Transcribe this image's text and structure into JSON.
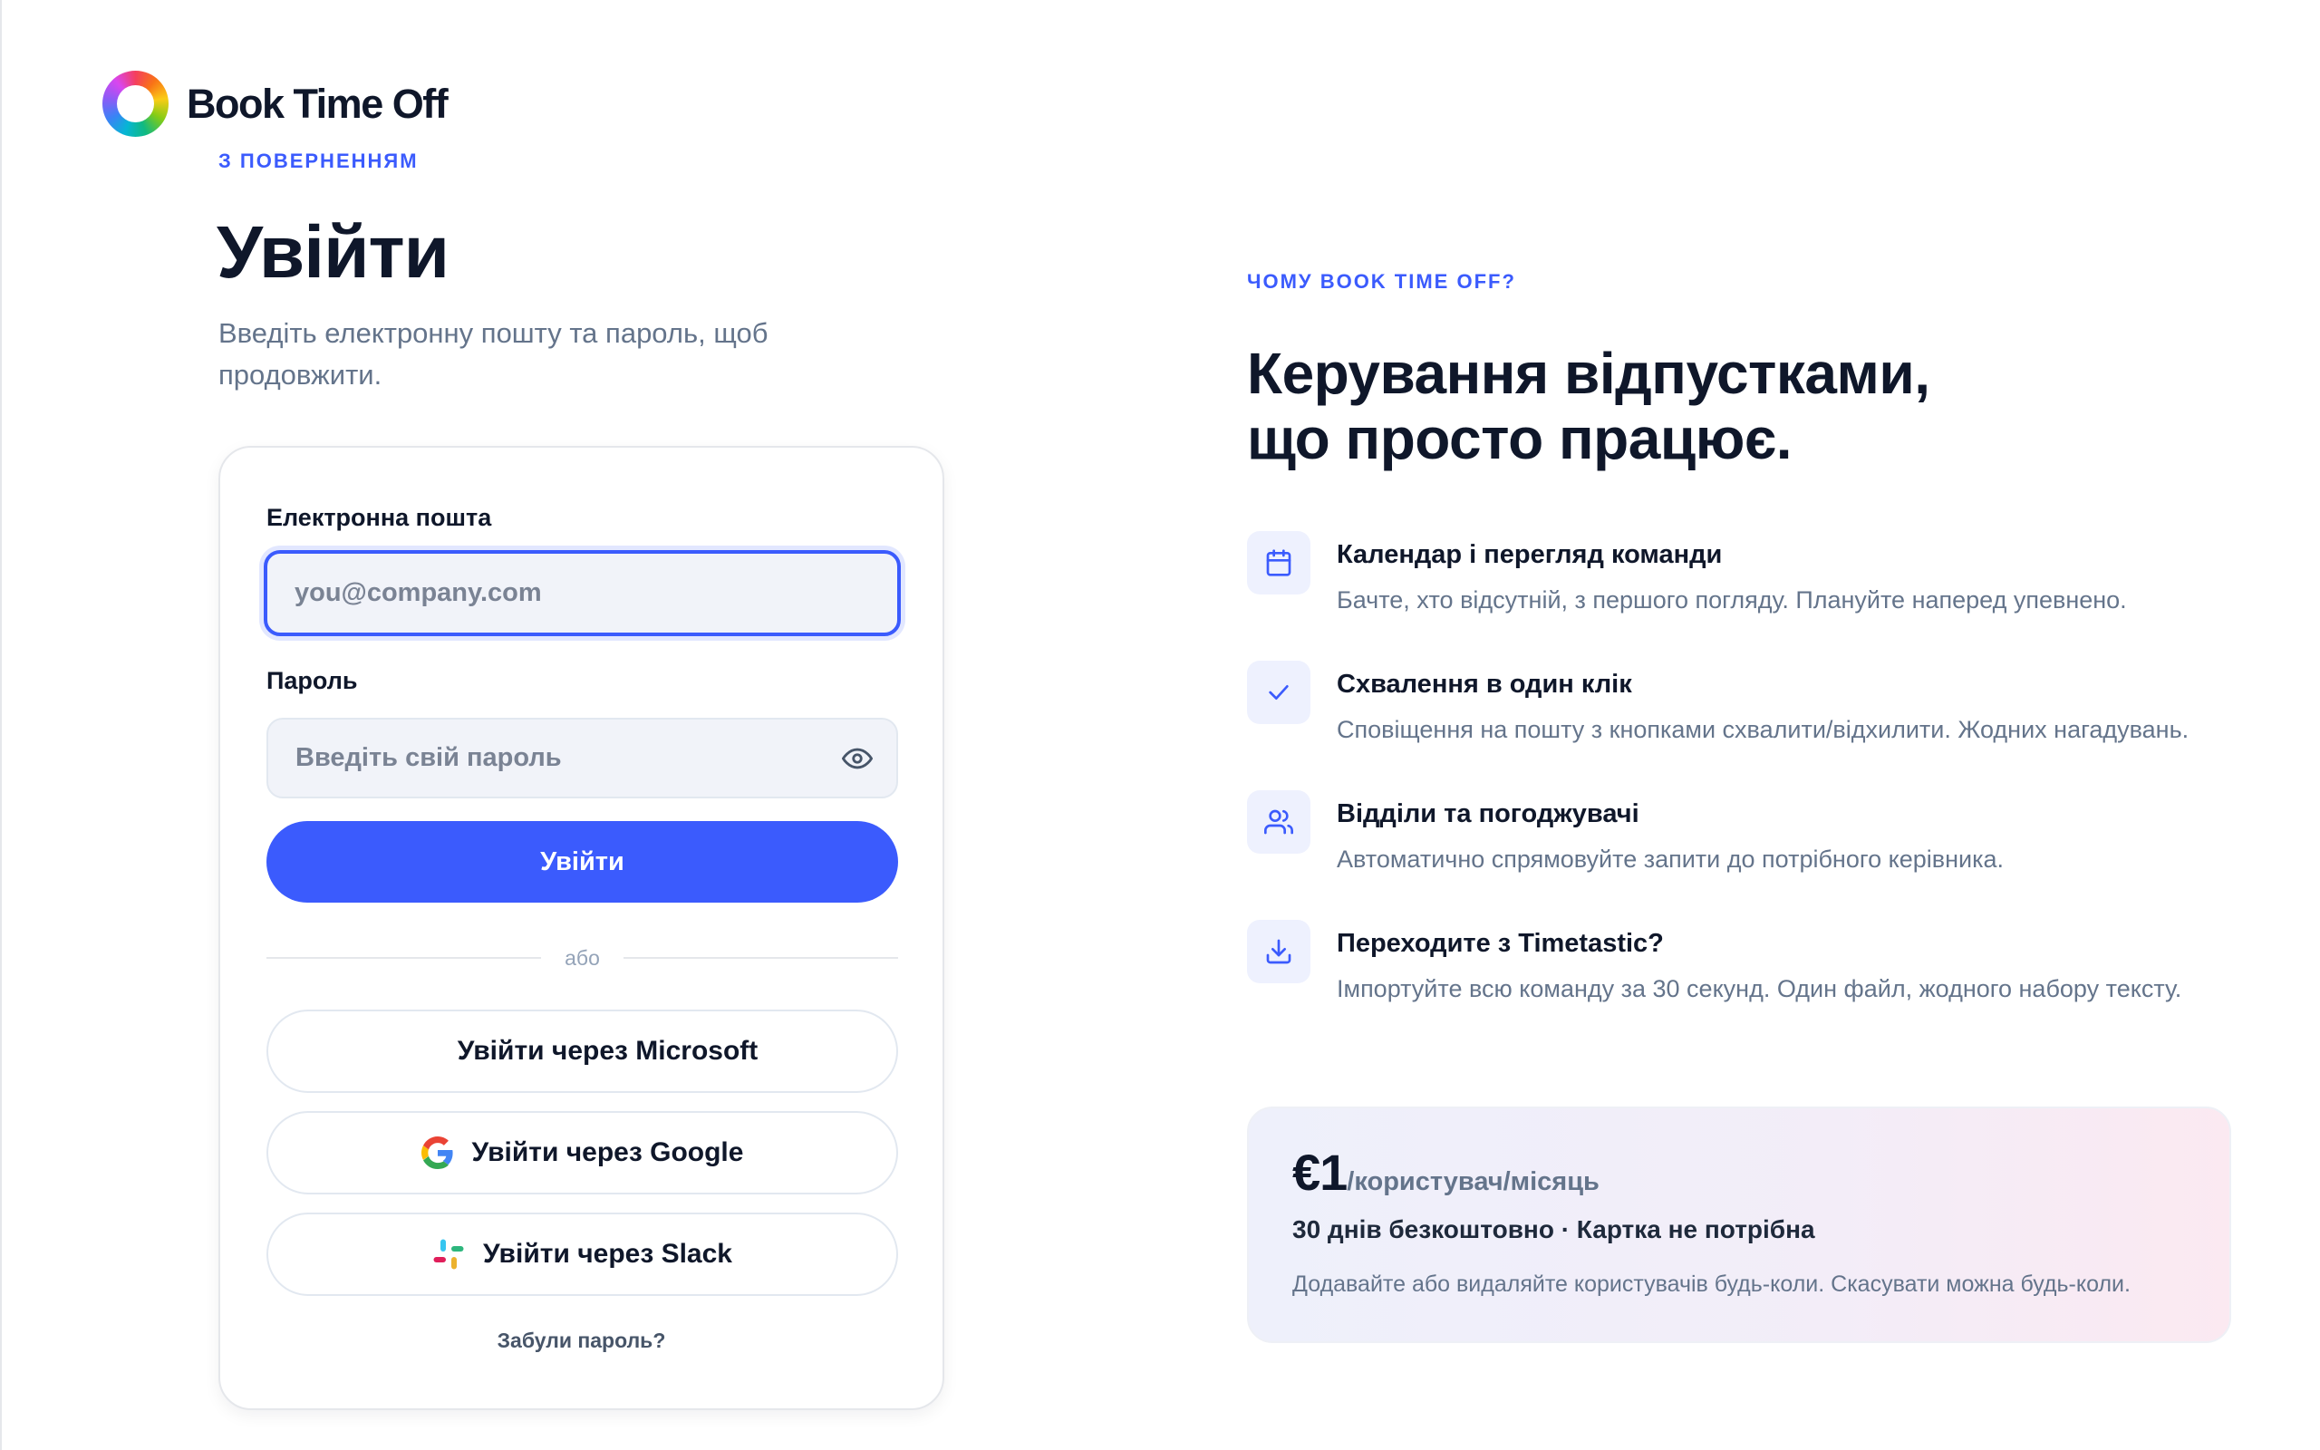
{
  "brand": {
    "name": "Book Time Off"
  },
  "login": {
    "eyebrow": "З ПОВЕРНЕННЯМ",
    "title": "Увійти",
    "subtitle": "Введіть електронну пошту та пароль, щоб продовжити.",
    "email": {
      "label": "Електронна пошта",
      "placeholder": "you@company.com",
      "value": ""
    },
    "password": {
      "label": "Пароль",
      "placeholder": "Введіть свій пароль",
      "value": ""
    },
    "submit_label": "Увійти",
    "divider_text": "або",
    "sso": [
      {
        "label": "Увійти через Microsoft",
        "icon": "microsoft-icon"
      },
      {
        "label": "Увійти через Google",
        "icon": "google-icon"
      },
      {
        "label": "Увійти через Slack",
        "icon": "slack-icon"
      }
    ],
    "forgot_label": "Забули пароль?"
  },
  "promo": {
    "eyebrow": "ЧОМУ BOOK TIME OFF?",
    "title_line1": "Керування відпустками,",
    "title_line2": "що просто працює.",
    "features": [
      {
        "icon": "calendar-icon",
        "title": "Календар і перегляд команди",
        "desc": "Бачте, хто відсутній, з першого погляду. Плануйте наперед упевнено."
      },
      {
        "icon": "check-icon",
        "title": "Схвалення в один клік",
        "desc": "Сповіщення на пошту з кнопками схвалити/відхилити. Жодних нагадувань."
      },
      {
        "icon": "users-icon",
        "title": "Відділи та погоджувачі",
        "desc": "Автоматично спрямовуйте запити до потрібного керівника."
      },
      {
        "icon": "download-icon",
        "title": "Переходите з Timetastic?",
        "desc": "Імпортуйте всю команду за 30 секунд. Один файл, жодного набору тексту."
      }
    ],
    "pricing": {
      "amount": "€1",
      "unit": "/користувач/місяць",
      "trial": "30 днів безкоштовно · Картка не потрібна",
      "note": "Додавайте або видаляйте користувачів будь-коли. Скасувати можна будь-коли."
    }
  },
  "colors": {
    "accent": "#3b5bfd",
    "text": "#0f172a",
    "muted": "#64748b"
  }
}
